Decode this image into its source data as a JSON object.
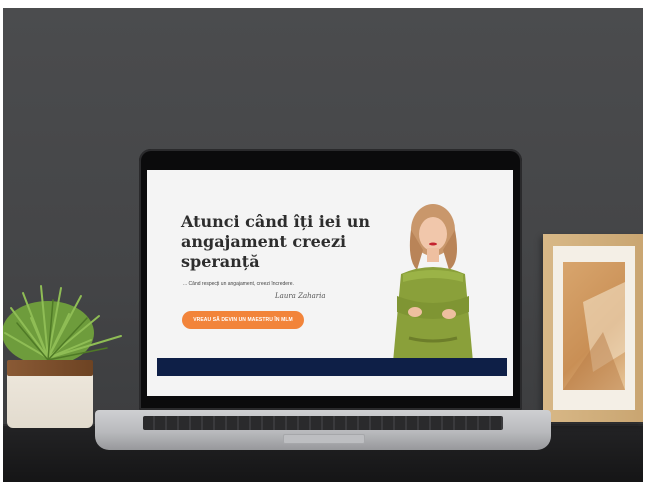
{
  "hero": {
    "title": "Atunci când îți iei un angajament creezi speranță",
    "tagline": "... Când respecți un angajament, creezi încredere.",
    "signature": "Laura Zaharia",
    "cta_label": "VREAU SĂ DEVIN UN MAESTRU ÎN MLM"
  },
  "colors": {
    "cta": "#f2843a",
    "navy_bar": "#0e1f47",
    "dress": "#8aa03a",
    "hair": "#c9976b"
  }
}
